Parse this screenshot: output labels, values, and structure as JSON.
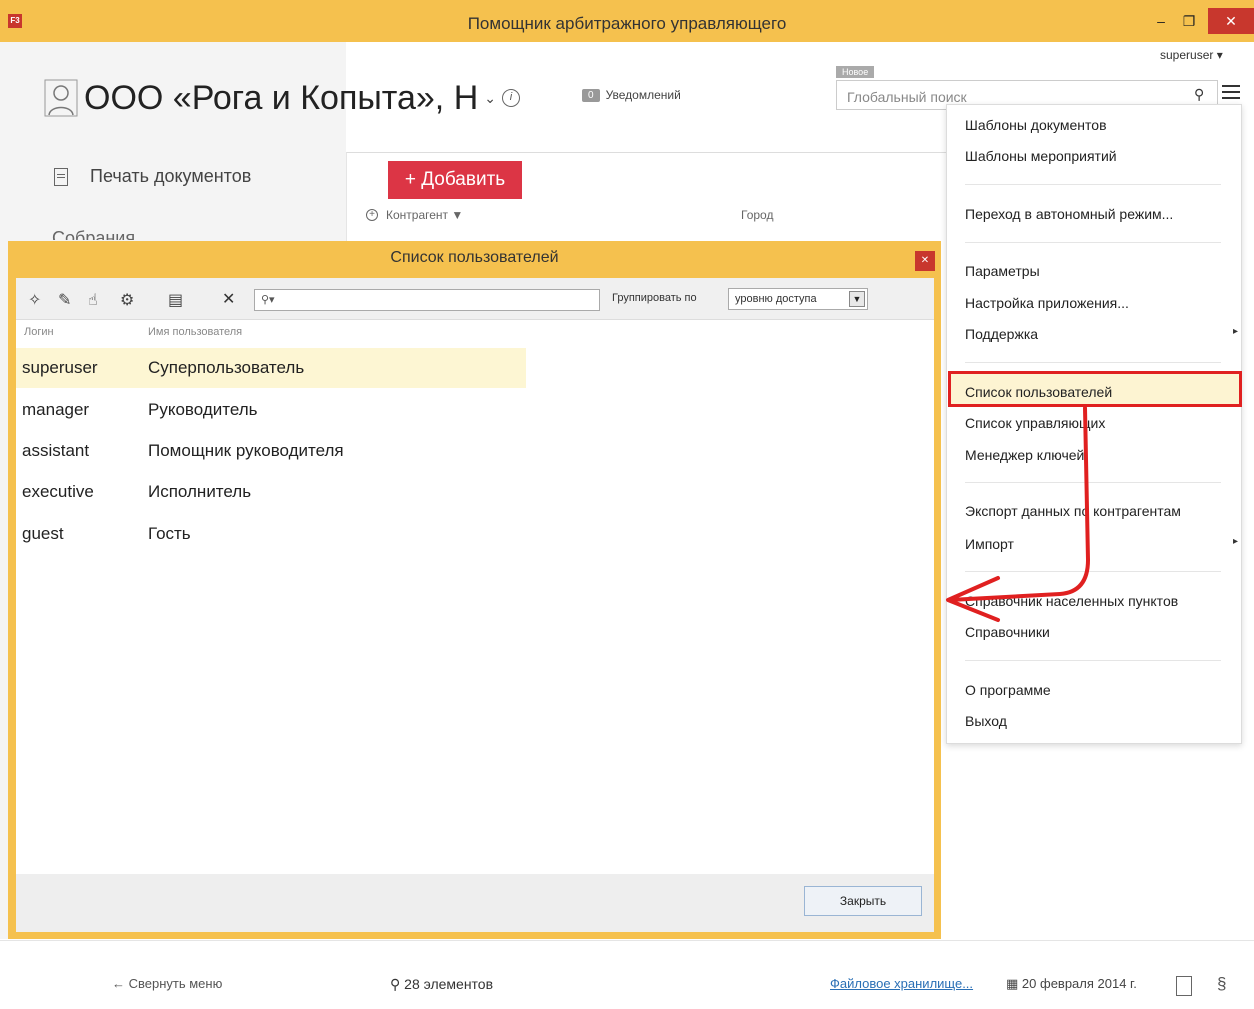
{
  "window": {
    "title": "Помощник арбитражного управляющего",
    "app_icon": "f3-app-icon"
  },
  "header": {
    "user": "superuser ▾",
    "company": "ООО «Рога и Копыта», Н",
    "notifications_count": "0",
    "notifications_label": "Уведомлений",
    "new_tag": "Новое",
    "search_placeholder": "Глобальный поиск"
  },
  "sidebar": {
    "print_docs": "Печать документов",
    "meetings": "Собрания",
    "collapse": "← Свернуть меню"
  },
  "main": {
    "add_button": "+ Добавить",
    "col_contractor": "Контрагент ▼",
    "col_city": "Город"
  },
  "status": {
    "count": "28 элементов",
    "filestore": "Файловое хранилище...",
    "date": "20 февраля 2014 г.",
    "section": "§"
  },
  "menu": {
    "items": [
      "Шаблоны документов",
      "Шаблоны мероприятий",
      "Переход в автономный режим...",
      "Параметры",
      "Настройка приложения...",
      "Поддержка",
      "Список пользователей",
      "Список управляющих",
      "Менеджер ключей",
      "Экспорт данных по контрагентам",
      "Импорт",
      "Справочник населенных пунктов",
      "Справочники",
      "О программе",
      "Выход"
    ]
  },
  "dialog": {
    "title": "Список пользователей",
    "group_by_label": "Группировать по",
    "group_by_value": "уровню доступа",
    "search_placeholder": "",
    "col_login": "Логин",
    "col_name": "Имя пользователя",
    "rows": [
      {
        "login": "superuser",
        "name": "Суперпользователь"
      },
      {
        "login": "manager",
        "name": "Руководитель"
      },
      {
        "login": "assistant",
        "name": "Помощник руководителя"
      },
      {
        "login": "executive",
        "name": "Исполнитель"
      },
      {
        "login": "guest",
        "name": "Гость"
      }
    ],
    "close_button": "Закрыть"
  },
  "colors": {
    "accent": "#f5c14e",
    "danger": "#dc3545",
    "highlight_border": "#e02020",
    "selected_row": "#fdf6d3"
  }
}
